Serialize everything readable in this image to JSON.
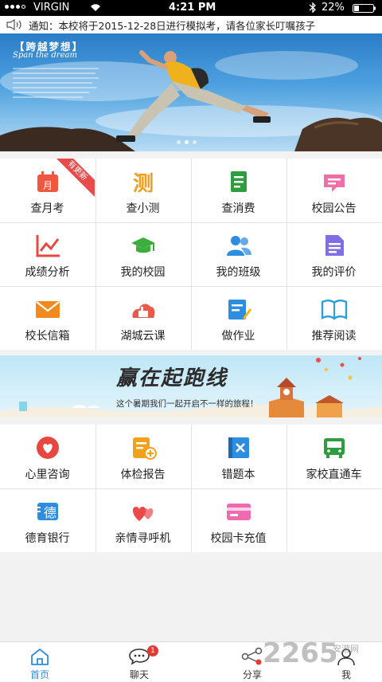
{
  "status_bar": {
    "carrier": "VIRGIN",
    "time": "4:21 PM",
    "battery": "22%"
  },
  "notice": {
    "text": "通知：本校将于2015-12-28日进行模拟考，请各位家长叮嘱孩子"
  },
  "banner": {
    "slogan": "【跨越梦想】",
    "slogan_en": "Span the dream",
    "slides": 3,
    "active_slide": 1
  },
  "grid1": {
    "items": [
      {
        "label": "查月考",
        "icon": "calendar-icon",
        "color": "#f0573f",
        "badge": "有更新"
      },
      {
        "label": "查小测",
        "icon": "test-icon",
        "color": "#f29d1b"
      },
      {
        "label": "查消费",
        "icon": "bill-icon",
        "color": "#2e9c3f"
      },
      {
        "label": "校园公告",
        "icon": "announcement-icon",
        "color": "#f06fa8"
      },
      {
        "label": "成绩分析",
        "icon": "chart-icon",
        "color": "#e8473f"
      },
      {
        "label": "我的校园",
        "icon": "graduation-cap-icon",
        "color": "#3cae3c"
      },
      {
        "label": "我的班级",
        "icon": "people-icon",
        "color": "#2d8ee0"
      },
      {
        "label": "我的评价",
        "icon": "document-icon",
        "color": "#7e6ee8"
      },
      {
        "label": "校长信箱",
        "icon": "mail-icon",
        "color": "#f08a1c"
      },
      {
        "label": "湖城云课",
        "icon": "cloud-class-icon",
        "color": "#e85a4a"
      },
      {
        "label": "做作业",
        "icon": "homework-icon",
        "color": "#2d8ee0"
      },
      {
        "label": "推荐阅读",
        "icon": "book-icon",
        "color": "#2d9fd8"
      }
    ]
  },
  "ad": {
    "headline": "赢在起跑线",
    "subtitle": "这个暑期我们一起开启不一样的旅程！"
  },
  "grid2": {
    "items": [
      {
        "label": "心里咨询",
        "icon": "heart-chat-icon",
        "color": "#e8473f"
      },
      {
        "label": "体检报告",
        "icon": "report-icon",
        "color": "#f2a11c"
      },
      {
        "label": "错题本",
        "icon": "wrong-book-icon",
        "color": "#2d8ee0"
      },
      {
        "label": "家校直通车",
        "icon": "bus-icon",
        "color": "#2e9c3f"
      },
      {
        "label": "德育银行",
        "icon": "moral-bank-icon",
        "color": "#2d8ee0"
      },
      {
        "label": "亲情寻呼机",
        "icon": "hearts-icon",
        "color": "#ec4a4a"
      },
      {
        "label": "校园卡充值",
        "icon": "card-icon",
        "color": "#ee6bb0"
      }
    ]
  },
  "tabbar": {
    "tabs": [
      {
        "label": "首页",
        "icon": "home-icon",
        "active": true
      },
      {
        "label": "聊天",
        "icon": "chat-icon",
        "badge": "1"
      },
      {
        "label": "分享",
        "icon": "share-icon"
      },
      {
        "label": "我",
        "icon": "user-icon"
      }
    ]
  },
  "watermark": {
    "text": "2265",
    "sub": "安游网"
  }
}
